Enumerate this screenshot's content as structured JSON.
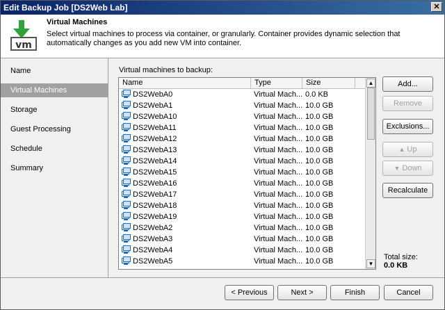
{
  "window": {
    "title": "Edit Backup Job [DS2Web Lab]",
    "close_glyph": "✕"
  },
  "header": {
    "icon": "vm-download-icon",
    "icon_text": "vm",
    "title": "Virtual Machines",
    "description": "Select virtual machines to process via container, or granularly. Container provides dynamic selection that automatically changes as you add new VM into container."
  },
  "nav": {
    "items": [
      {
        "label": "Name"
      },
      {
        "label": "Virtual Machines",
        "active": true
      },
      {
        "label": "Storage"
      },
      {
        "label": "Guest Processing"
      },
      {
        "label": "Schedule"
      },
      {
        "label": "Summary"
      }
    ]
  },
  "vm_list": {
    "label": "Virtual machines to backup:",
    "columns": [
      "Name",
      "Type",
      "Size"
    ],
    "rows": [
      {
        "name": "DS2WebA0",
        "type": "Virtual Mach...",
        "size": "0.0 KB"
      },
      {
        "name": "DS2WebA1",
        "type": "Virtual Mach...",
        "size": "10.0 GB"
      },
      {
        "name": "DS2WebA10",
        "type": "Virtual Mach...",
        "size": "10.0 GB"
      },
      {
        "name": "DS2WebA11",
        "type": "Virtual Mach...",
        "size": "10.0 GB"
      },
      {
        "name": "DS2WebA12",
        "type": "Virtual Mach...",
        "size": "10.0 GB"
      },
      {
        "name": "DS2WebA13",
        "type": "Virtual Mach...",
        "size": "10.0 GB"
      },
      {
        "name": "DS2WebA14",
        "type": "Virtual Mach...",
        "size": "10.0 GB"
      },
      {
        "name": "DS2WebA15",
        "type": "Virtual Mach...",
        "size": "10.0 GB"
      },
      {
        "name": "DS2WebA16",
        "type": "Virtual Mach...",
        "size": "10.0 GB"
      },
      {
        "name": "DS2WebA17",
        "type": "Virtual Mach...",
        "size": "10.0 GB"
      },
      {
        "name": "DS2WebA18",
        "type": "Virtual Mach...",
        "size": "10.0 GB"
      },
      {
        "name": "DS2WebA19",
        "type": "Virtual Mach...",
        "size": "10.0 GB"
      },
      {
        "name": "DS2WebA2",
        "type": "Virtual Mach...",
        "size": "10.0 GB"
      },
      {
        "name": "DS2WebA3",
        "type": "Virtual Mach...",
        "size": "10.0 GB"
      },
      {
        "name": "DS2WebA4",
        "type": "Virtual Mach...",
        "size": "10.0 GB"
      },
      {
        "name": "DS2WebA5",
        "type": "Virtual Mach...",
        "size": "10.0 GB"
      }
    ]
  },
  "side_buttons": {
    "add": "Add...",
    "remove": "Remove",
    "exclusions": "Exclusions...",
    "up": "Up",
    "down": "Down",
    "recalculate": "Recalculate"
  },
  "total": {
    "label": "Total size:",
    "value": "0.0 KB"
  },
  "footer": {
    "previous": "< Previous",
    "next": "Next >",
    "finish": "Finish",
    "cancel": "Cancel"
  },
  "colors": {
    "titlebar": "#0a246a",
    "nav_active": "#a0a0a0",
    "vm_icon": "#1e6bc5"
  }
}
